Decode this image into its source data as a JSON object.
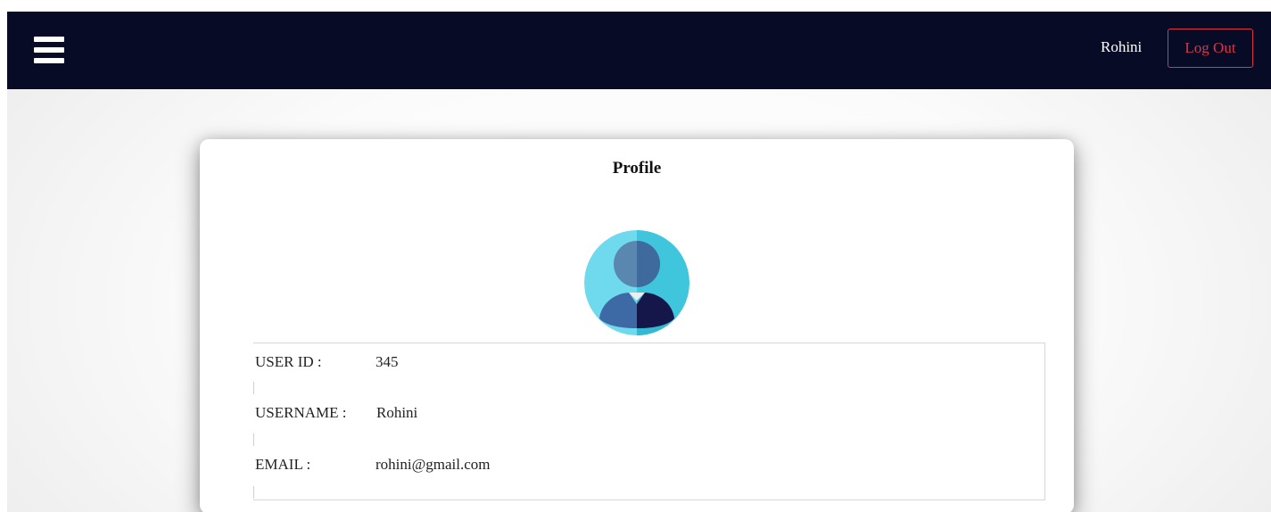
{
  "header": {
    "menu_icon": "hamburger-menu-icon",
    "username": "Rohini",
    "logout_label": "Log Out",
    "background": "#070b26",
    "logout_color": "#dc3545"
  },
  "profile": {
    "title": "Profile",
    "avatar_icon": "user-avatar-icon",
    "fields": [
      {
        "label": "USER ID :",
        "value": "345"
      },
      {
        "label": "USERNAME :",
        "value": "Rohini"
      },
      {
        "label": "EMAIL :",
        "value": "rohini@gmail.com"
      }
    ]
  }
}
